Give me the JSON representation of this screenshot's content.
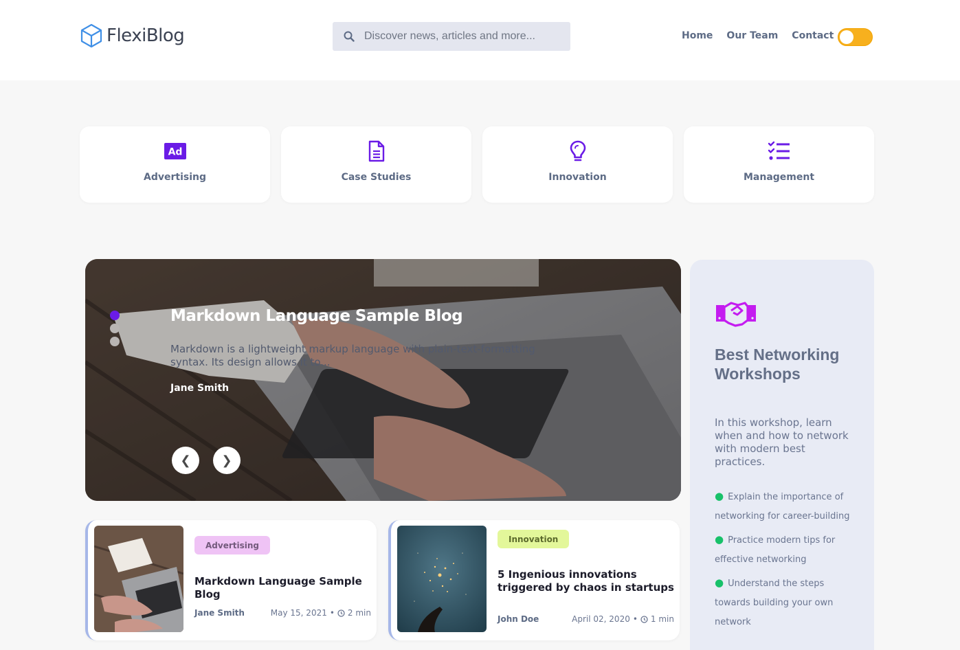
{
  "brand": {
    "name": "FlexiBlog",
    "icon": "cube-icon",
    "accent": "#6a1be6"
  },
  "search": {
    "placeholder": "Discover news, articles and more...",
    "icon": "search-icon"
  },
  "nav": {
    "items": [
      {
        "label": "Home"
      },
      {
        "label": "Our Team"
      },
      {
        "label": "Contact"
      }
    ]
  },
  "theme_toggle": {
    "icon": "theme-toggle",
    "color": "#f7b01e"
  },
  "categories": [
    {
      "label": "Advertising",
      "icon": "ad-icon"
    },
    {
      "label": "Case Studies",
      "icon": "document-icon"
    },
    {
      "label": "Innovation",
      "icon": "lightbulb-icon"
    },
    {
      "label": "Management",
      "icon": "checklist-icon"
    }
  ],
  "hero": {
    "title": "Markdown Language Sample Blog",
    "excerpt": "Markdown is a lightweight markup language with plain-text-formatting syntax. Its design allows it to...",
    "author": "Jane Smith",
    "slides": 3,
    "active_slide": 1,
    "prev_label": "❮",
    "next_label": "❯"
  },
  "sidebar": {
    "icon": "handshake-icon",
    "title": "Best Networking Workshops",
    "description": "In this workshop, learn when and how to network with modern best practices.",
    "bullets": [
      "Explain the importance of networking for career-building",
      "Practice modern tips for effective networking",
      "Understand the steps towards building your own network"
    ],
    "bullet_color": "#18c16a"
  },
  "posts": [
    {
      "tag": "Advertising",
      "title": "Markdown Language Sample Blog",
      "author": "Jane Smith",
      "date": "May 15, 2021",
      "read_time": "2 min"
    },
    {
      "tag": "Innovation",
      "title": "5 Ingenious innovations triggered by chaos in startups",
      "author": "John Doe",
      "date": "April 02, 2020",
      "read_time": "1 min"
    }
  ]
}
